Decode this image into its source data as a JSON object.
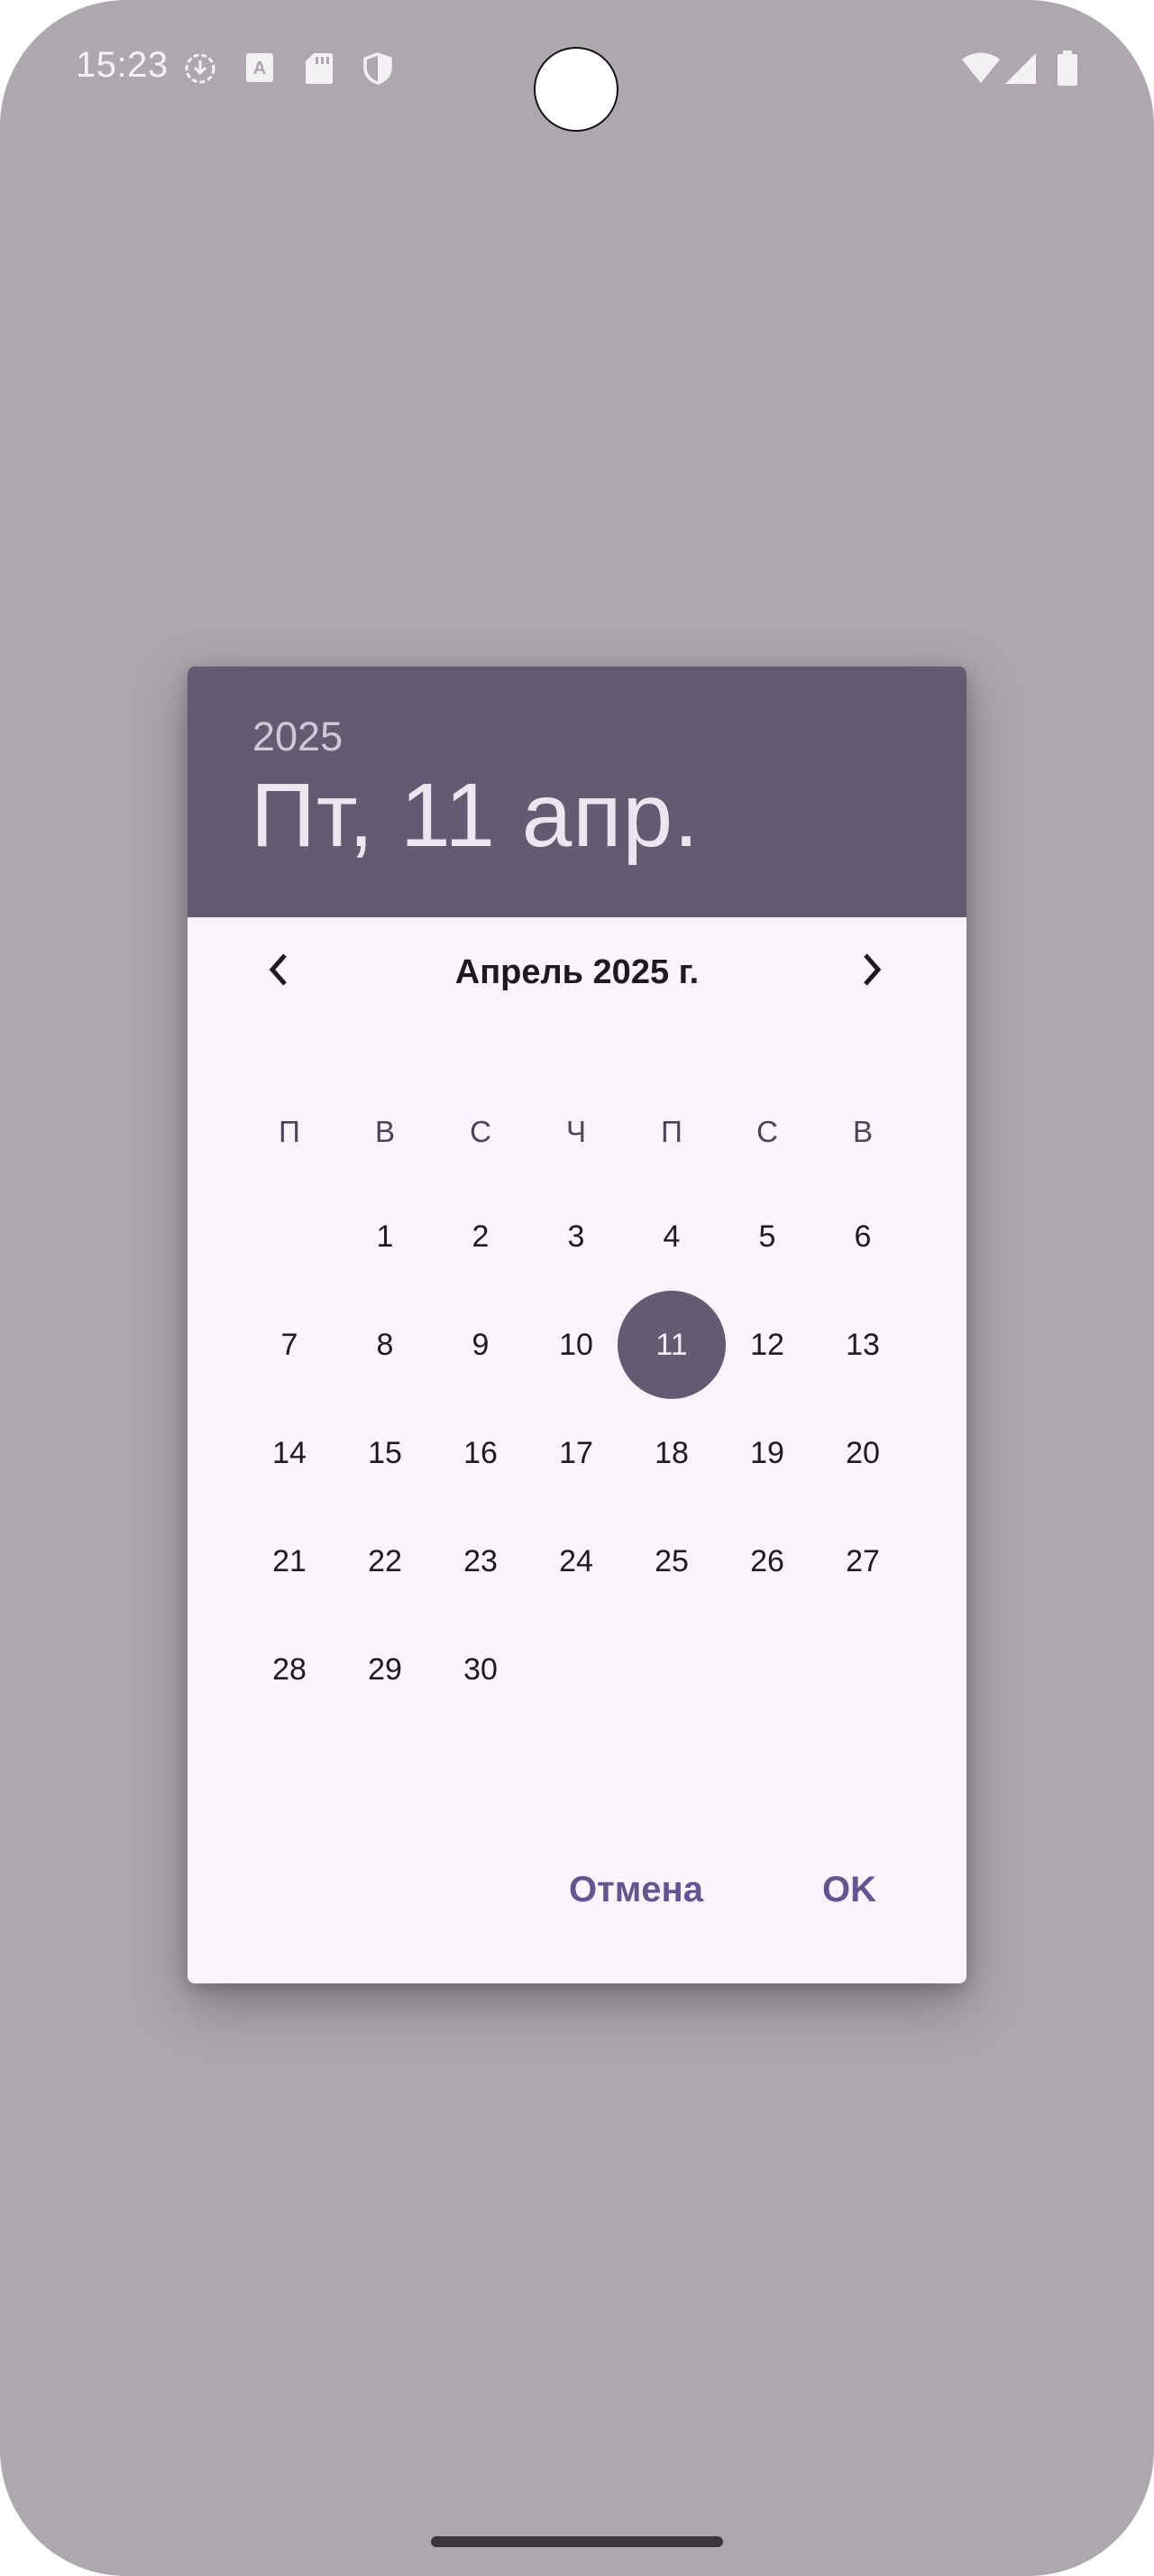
{
  "status_bar": {
    "time": "15:23",
    "icons": [
      "download-circle-icon",
      "font-a-icon",
      "sd-card-icon",
      "shield-icon",
      "wifi-icon",
      "signal-icon",
      "battery-icon"
    ]
  },
  "dialog": {
    "header": {
      "year": "2025",
      "selected_date": "Пт, 11 апр."
    },
    "month_title": "Апрель 2025 г.",
    "prev_icon": "chevron-left-icon",
    "next_icon": "chevron-right-icon",
    "weekdays": [
      "П",
      "В",
      "С",
      "Ч",
      "П",
      "С",
      "В"
    ],
    "days": [
      "1",
      "2",
      "3",
      "4",
      "5",
      "6",
      "7",
      "8",
      "9",
      "10",
      "11",
      "12",
      "13",
      "14",
      "15",
      "16",
      "17",
      "18",
      "19",
      "20",
      "21",
      "22",
      "23",
      "24",
      "25",
      "26",
      "27",
      "28",
      "29",
      "30"
    ],
    "selected_day": "11",
    "cancel_label": "Отмена",
    "ok_label": "OK"
  },
  "colors": {
    "scrim": "#aca8ad",
    "header": "#645b73",
    "surface": "#fbf4fc",
    "accent_text": "#65558f"
  }
}
